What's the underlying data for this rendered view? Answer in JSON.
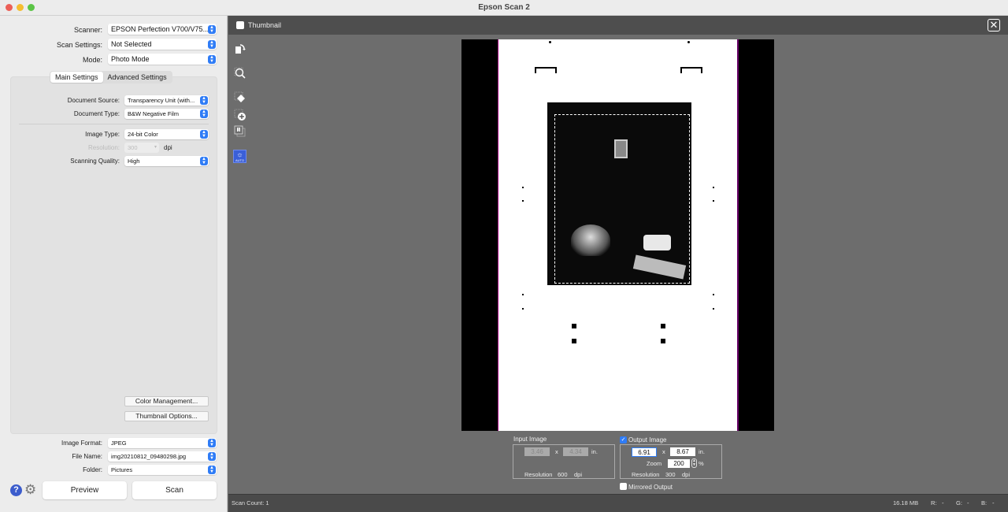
{
  "window": {
    "title": "Epson Scan 2"
  },
  "settings": {
    "scanner": {
      "label": "Scanner:",
      "value": "EPSON Perfection V700/V75..."
    },
    "scan_settings": {
      "label": "Scan Settings:",
      "value": "Not Selected"
    },
    "mode": {
      "label": "Mode:",
      "value": "Photo Mode"
    }
  },
  "tabs": [
    {
      "label": "Main Settings",
      "active": true
    },
    {
      "label": "Advanced Settings",
      "active": false
    }
  ],
  "main_settings": {
    "document_source": {
      "label": "Document Source:",
      "value": "Transparency Unit (with..."
    },
    "document_type": {
      "label": "Document Type:",
      "value": "B&W Negative Film"
    },
    "image_type": {
      "label": "Image Type:",
      "value": "24-bit Color"
    },
    "resolution": {
      "label": "Resolution:",
      "value": "300",
      "unit": "dpi",
      "disabled": true
    },
    "scanning_quality": {
      "label": "Scanning Quality:",
      "value": "High"
    },
    "color_management_button": "Color Management...",
    "thumbnail_options_button": "Thumbnail Options..."
  },
  "output": {
    "image_format": {
      "label": "Image Format:",
      "value": "JPEG"
    },
    "file_name": {
      "label": "File Name:",
      "value": "img20210812_09480298.jpg"
    },
    "folder": {
      "label": "Folder:",
      "value": "Pictures"
    }
  },
  "actions": {
    "preview": "Preview",
    "scan": "Scan"
  },
  "icons": {
    "help": "?",
    "settings": "⚙",
    "close": "✕"
  },
  "thumbnail": {
    "label": "Thumbnail",
    "checked": false
  },
  "toolbar_icons": [
    "rotate-icon",
    "zoom-icon",
    "erase-marquee-icon",
    "add-marquee-icon",
    "copy-marquee-icon",
    "auto-exposure-icon"
  ],
  "auto_label": "AUTO",
  "input_image": {
    "title": "Input Image",
    "width": "3.46",
    "height": "4.34",
    "x_sep": "x",
    "unit": "in.",
    "resolution_label": "Resolution",
    "resolution": "600",
    "resolution_unit": "dpi"
  },
  "output_image": {
    "title": "Output Image",
    "checked": true,
    "width": "6.91",
    "height": "8.67",
    "x_sep": "x",
    "unit": "in.",
    "zoom_label": "Zoom",
    "zoom": "200",
    "zoom_unit": "%",
    "resolution_label": "Resolution",
    "resolution": "300",
    "resolution_unit": "dpi"
  },
  "mirrored_output": {
    "label": "Mirrored Output",
    "checked": false
  },
  "status": {
    "scan_count": "Scan Count: 1",
    "file_size": "16.18 MB",
    "r_label": "R:",
    "r": "-",
    "g_label": "G:",
    "g": "-",
    "b_label": "B:",
    "b": "-"
  }
}
